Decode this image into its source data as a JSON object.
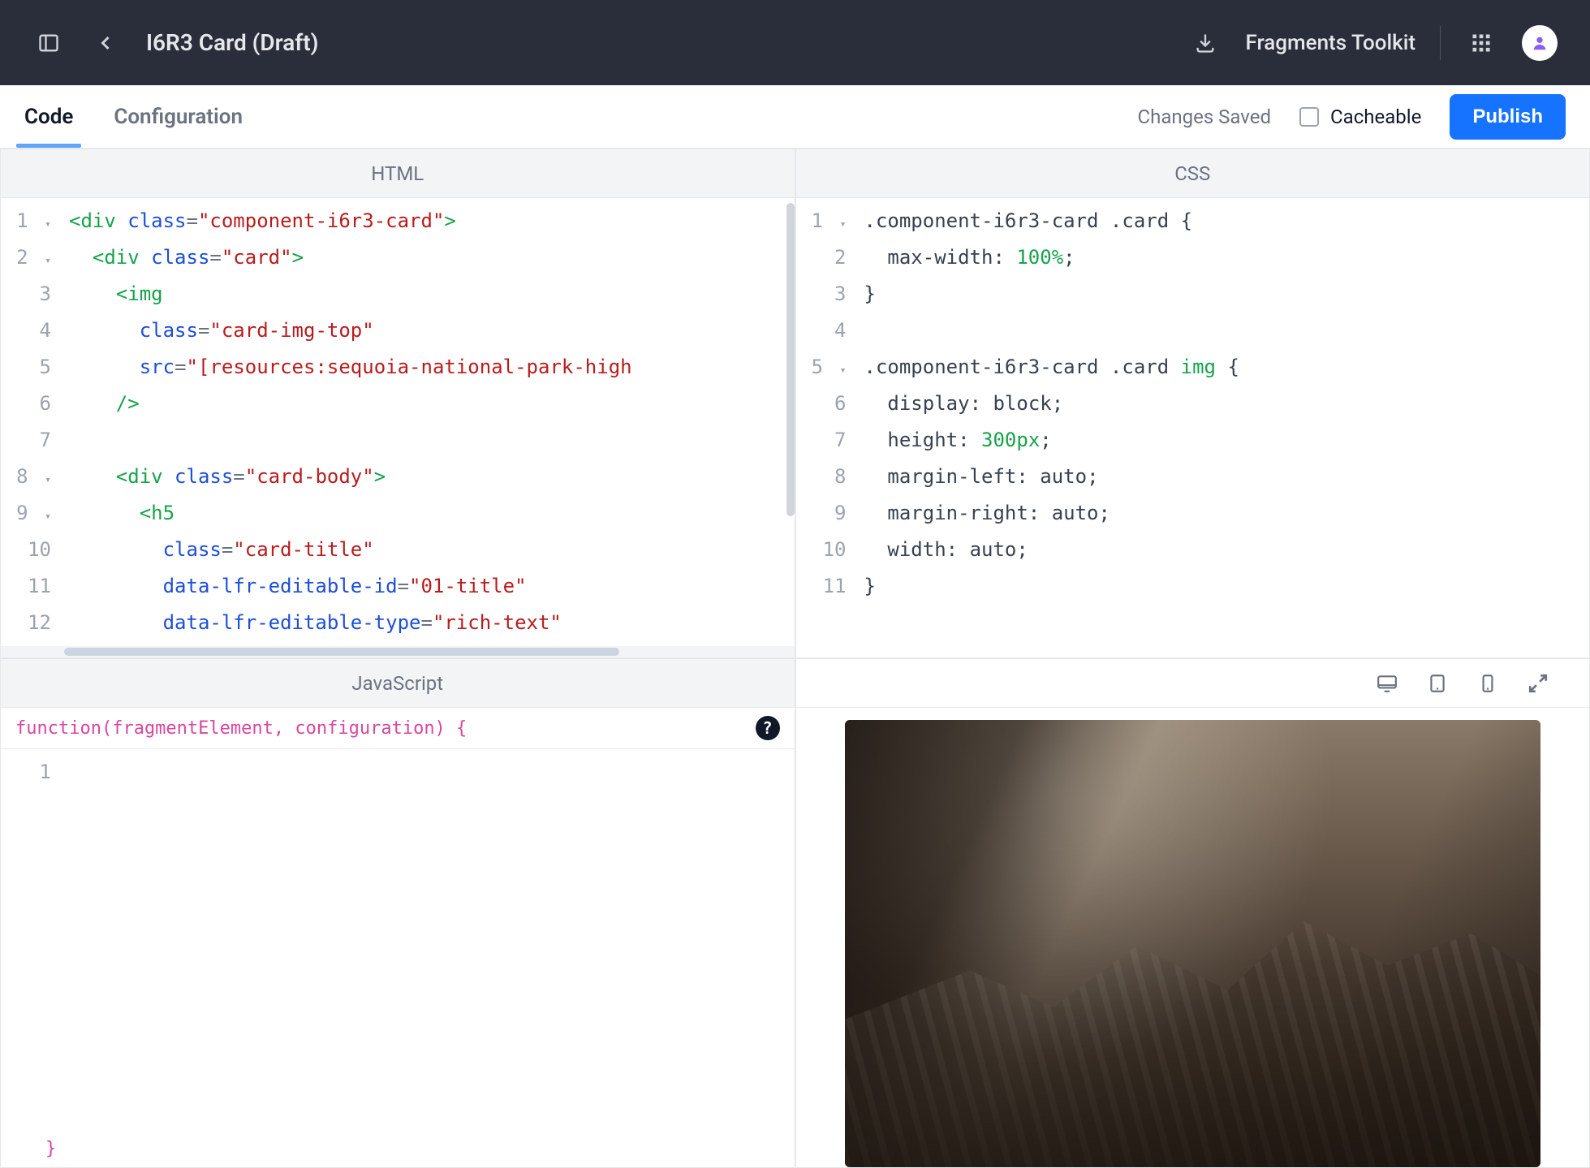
{
  "topbar": {
    "title": "I6R3 Card (Draft)",
    "toolkit_label": "Fragments Toolkit"
  },
  "subnav": {
    "tabs": [
      "Code",
      "Configuration"
    ],
    "active": 0,
    "status": "Changes Saved",
    "cacheable_label": "Cacheable",
    "publish_label": "Publish"
  },
  "panes": {
    "html": {
      "title": "HTML"
    },
    "css": {
      "title": "CSS"
    },
    "js": {
      "title": "JavaScript",
      "signature": "function(fragmentElement, configuration) {",
      "close": "}"
    }
  },
  "code": {
    "html": [
      {
        "n": 1,
        "fold": true,
        "tokens": [
          [
            "tag",
            "<div"
          ],
          [
            "plain",
            " "
          ],
          [
            "attr",
            "class"
          ],
          [
            "punct",
            "="
          ],
          [
            "str",
            "\"component-i6r3-card\""
          ],
          [
            "tag",
            ">"
          ]
        ]
      },
      {
        "n": 2,
        "fold": true,
        "indent": 1,
        "tokens": [
          [
            "tag",
            "<div"
          ],
          [
            "plain",
            " "
          ],
          [
            "attr",
            "class"
          ],
          [
            "punct",
            "="
          ],
          [
            "str",
            "\"card\""
          ],
          [
            "tag",
            ">"
          ]
        ]
      },
      {
        "n": 3,
        "indent": 2,
        "tokens": [
          [
            "tag",
            "<img"
          ]
        ]
      },
      {
        "n": 4,
        "indent": 3,
        "tokens": [
          [
            "attr",
            "class"
          ],
          [
            "punct",
            "="
          ],
          [
            "str",
            "\"card-img-top\""
          ]
        ]
      },
      {
        "n": 5,
        "indent": 3,
        "tokens": [
          [
            "attr",
            "src"
          ],
          [
            "punct",
            "="
          ],
          [
            "str",
            "\"[resources:sequoia-national-park-high"
          ]
        ]
      },
      {
        "n": 6,
        "indent": 2,
        "tokens": [
          [
            "tag",
            "/>"
          ]
        ]
      },
      {
        "n": 7,
        "indent": 0,
        "tokens": []
      },
      {
        "n": 8,
        "fold": true,
        "indent": 2,
        "tokens": [
          [
            "tag",
            "<div"
          ],
          [
            "plain",
            " "
          ],
          [
            "attr",
            "class"
          ],
          [
            "punct",
            "="
          ],
          [
            "str",
            "\"card-body\""
          ],
          [
            "tag",
            ">"
          ]
        ]
      },
      {
        "n": 9,
        "fold": true,
        "indent": 3,
        "tokens": [
          [
            "tag",
            "<h5"
          ]
        ]
      },
      {
        "n": 10,
        "indent": 4,
        "tokens": [
          [
            "attr",
            "class"
          ],
          [
            "punct",
            "="
          ],
          [
            "str",
            "\"card-title\""
          ]
        ]
      },
      {
        "n": 11,
        "indent": 4,
        "tokens": [
          [
            "attr",
            "data-lfr-editable-id"
          ],
          [
            "punct",
            "="
          ],
          [
            "str",
            "\"01-title\""
          ]
        ]
      },
      {
        "n": 12,
        "indent": 4,
        "tokens": [
          [
            "attr",
            "data-lfr-editable-type"
          ],
          [
            "punct",
            "="
          ],
          [
            "str",
            "\"rich-text\""
          ]
        ]
      }
    ],
    "css": [
      {
        "n": 1,
        "fold": true,
        "tokens": [
          [
            "sel",
            ".component-i6r3-card .card "
          ],
          [
            "brace",
            "{"
          ]
        ]
      },
      {
        "n": 2,
        "indent": 1,
        "tokens": [
          [
            "prop",
            "max-width"
          ],
          [
            "punct",
            ": "
          ],
          [
            "num",
            "100%"
          ],
          [
            "punct",
            ";"
          ]
        ]
      },
      {
        "n": 3,
        "tokens": [
          [
            "brace",
            "}"
          ]
        ]
      },
      {
        "n": 4,
        "tokens": []
      },
      {
        "n": 5,
        "fold": true,
        "tokens": [
          [
            "sel",
            ".component-i6r3-card .card "
          ],
          [
            "csstag",
            "img "
          ],
          [
            "brace",
            "{"
          ]
        ]
      },
      {
        "n": 6,
        "indent": 1,
        "tokens": [
          [
            "prop",
            "display"
          ],
          [
            "punct",
            ": "
          ],
          [
            "val",
            "block"
          ],
          [
            "punct",
            ";"
          ]
        ]
      },
      {
        "n": 7,
        "indent": 1,
        "tokens": [
          [
            "prop",
            "height"
          ],
          [
            "punct",
            ": "
          ],
          [
            "num",
            "300px"
          ],
          [
            "punct",
            ";"
          ]
        ]
      },
      {
        "n": 8,
        "indent": 1,
        "tokens": [
          [
            "prop",
            "margin-left"
          ],
          [
            "punct",
            ": "
          ],
          [
            "val",
            "auto"
          ],
          [
            "punct",
            ";"
          ]
        ]
      },
      {
        "n": 9,
        "indent": 1,
        "tokens": [
          [
            "prop",
            "margin-right"
          ],
          [
            "punct",
            ": "
          ],
          [
            "val",
            "auto"
          ],
          [
            "punct",
            ";"
          ]
        ]
      },
      {
        "n": 10,
        "indent": 1,
        "tokens": [
          [
            "prop",
            "width"
          ],
          [
            "punct",
            ": "
          ],
          [
            "val",
            "auto"
          ],
          [
            "punct",
            ";"
          ]
        ]
      },
      {
        "n": 11,
        "tokens": [
          [
            "brace",
            "}"
          ]
        ]
      }
    ],
    "js": [
      {
        "n": 1,
        "tokens": []
      }
    ]
  }
}
